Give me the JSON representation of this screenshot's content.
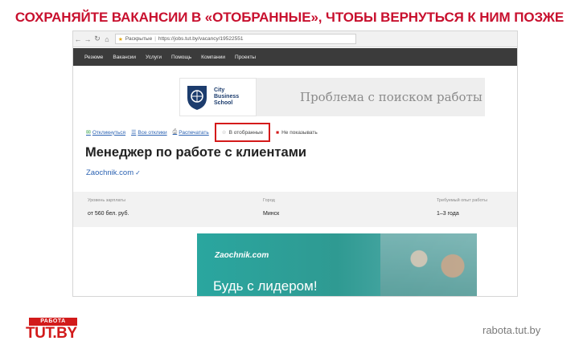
{
  "slide": {
    "title": "СОХРАНЯЙТЕ ВАКАНСИИ В «ОТОБРАННЫЕ», ЧТОБЫ ВЕРНУТЬСЯ К НИМ ПОЗЖЕ",
    "footer_domain": "rabota.tut.by",
    "logo_top": "РАБОТА",
    "logo_main": "TUT.BY"
  },
  "browser": {
    "bookmark_label": "Раскрытые",
    "url": "https://jobs.tut.by/vacancy/19522551"
  },
  "site_nav": {
    "items": [
      "Резюме",
      "Вакансии",
      "Услуги",
      "Помощь",
      "Компании",
      "Проекты"
    ]
  },
  "banner": {
    "school_name_1": "City",
    "school_name_2": "Business",
    "school_name_3": "School",
    "ad_text": "Проблема с поиском работы"
  },
  "actions": {
    "items": [
      "Откликнуться",
      "Все отклики",
      "Распечатать"
    ],
    "selected": "В отобранные",
    "hide": "Не показывать"
  },
  "vacancy": {
    "title": "Менеджер по работе с клиентами",
    "company": "Zaochnik.com"
  },
  "info": {
    "salary_label": "Уровень зарплаты",
    "salary_value": "от 560 бел. руб.",
    "city_label": "Город",
    "city_value": "Минск",
    "exp_label": "Требуемый опыт работы",
    "exp_value": "1–3 года"
  },
  "ad": {
    "logo": "Zaochnik.com",
    "slogan": "Будь с лидером!"
  },
  "colors": {
    "accent_red": "#d21a1a",
    "link_blue": "#2b62b2",
    "nav_dark": "#3b3b3b",
    "ad_teal": "#2aa69f"
  }
}
